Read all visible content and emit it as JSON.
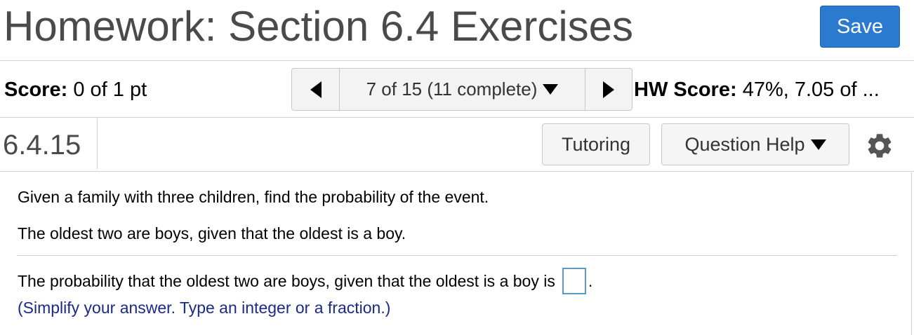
{
  "header": {
    "title": "Homework: Section 6.4 Exercises",
    "save_label": "Save",
    "accent_color": "#2a7bd0"
  },
  "score_bar": {
    "score_label": "Score:",
    "score_value": "0 of 1 pt",
    "nav_status": "7 of 15 (11 complete)",
    "hw_score_label": "HW Score:",
    "hw_score_value": "47%, 7.05 of ..."
  },
  "question_bar": {
    "question_id": "6.4.15",
    "tutoring_label": "Tutoring",
    "help_label": "Question Help"
  },
  "question": {
    "prompt": "Given a family with three children, find the probability of the event.",
    "event": "The oldest two are boys, given that the oldest is a boy.",
    "answer_prefix": "The probability that the oldest two are boys, given that the oldest is a boy is",
    "answer_suffix": ".",
    "answer_value": "",
    "hint": "(Simplify your answer. Type an integer or a fraction.)",
    "hint_color": "#1b2a8a"
  },
  "icons": {
    "prev": "triangle-left-icon",
    "next": "triangle-right-icon",
    "dropdown": "chevron-down-icon",
    "settings": "gear-icon"
  }
}
